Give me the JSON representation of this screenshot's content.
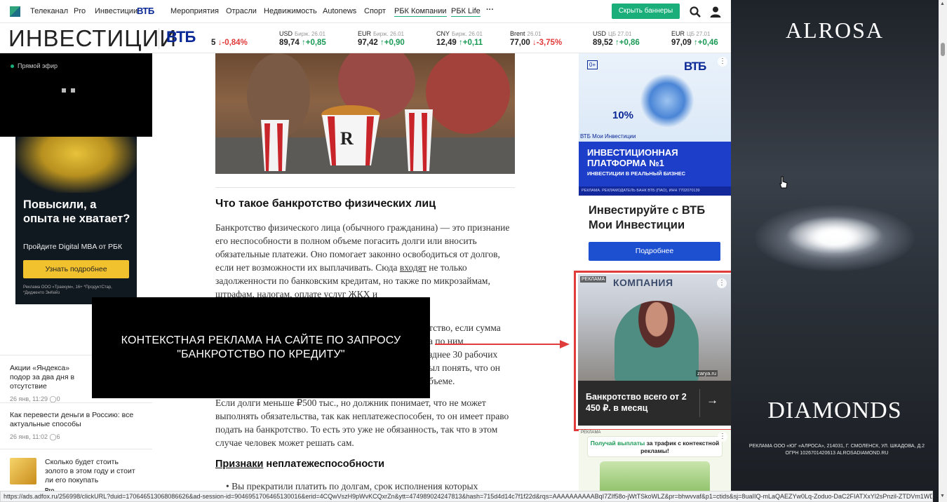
{
  "nav": {
    "items": [
      "Телеканал",
      "Pro",
      "Инвестиции",
      "ВТБ",
      "Мероприятия",
      "Отрасли",
      "Недвижимость",
      "Autonews",
      "Спорт",
      "РБК Компании",
      "РБК Life",
      "···"
    ],
    "hide_banners": "Скрыть баннеры"
  },
  "brand": {
    "title": "ИНВЕСТИЦИИ",
    "partner": "ВТБ"
  },
  "tickers": [
    {
      "name": "",
      "sub": "",
      "value": "5",
      "change": "-0,84%",
      "dir": "down"
    },
    {
      "name": "USD",
      "sub": "Бирж. 26.01",
      "value": "89,74",
      "change": "+0,85",
      "dir": "up"
    },
    {
      "name": "EUR",
      "sub": "Бирж. 26.01",
      "value": "97,42",
      "change": "+0,90",
      "dir": "up"
    },
    {
      "name": "CNY",
      "sub": "Бирж. 26.01",
      "value": "12,49",
      "change": "+0,11",
      "dir": "up"
    },
    {
      "name": "Brent",
      "sub": "26.01",
      "value": "77,00",
      "change": "-3,75%",
      "dir": "down"
    },
    {
      "name": "USD",
      "sub": "ЦБ 27.01",
      "value": "89,52",
      "change": "+0,86",
      "dir": "up"
    },
    {
      "name": "EUR",
      "sub": "ЦБ 27.01",
      "value": "97,09",
      "change": "+0,46",
      "dir": "up"
    }
  ],
  "left": {
    "live_label": "Прямой эфир",
    "mba_ad": {
      "headline": "Повысили, а опыта не хватает?",
      "sub": "Пройдите Digital MBA от РБК",
      "button": "Узнать подробнее",
      "legal": "Реклама ООО «Траекум», 16+ *ПродуктСтар, *Дидженто ЭнКейз"
    },
    "news": [
      {
        "title": "Акции «Яндекса» подор за два дня в отсутствие",
        "time": "26 янв, 11:29",
        "comments": "0"
      },
      {
        "title": "Как перевести деньги в Россию: все актуальные способы",
        "time": "26 янв, 11:02",
        "comments": "6"
      },
      {
        "title": "Сколько будет стоить золото в этом году и стоит ли его покупать",
        "badge": "Pro"
      }
    ]
  },
  "article": {
    "heading": "Что такое банкротство физических лиц",
    "p1": "Банкротство физического лица (обычного гражданина) — это признание его неспособности в полном объеме погасить долги или вносить обязательные платежи. Оно помогает законно освободиться от долгов, если нет возможности их выплачивать.",
    "p1b_pre": "Сюда ",
    "p1b_link": "входят",
    "p1b_post": " не только задолженности по банковским кредитам, но также по микрозаймам, штрафам, налогам, оплате услуг ЖКХ и",
    "p2_frag": [
      "тство, если сумма",
      "а по ним",
      "зднее 30 рабочих",
      "ыл понять, что он",
      "бъеме."
    ],
    "p3": "Если долги меньше ₽500 тыс., но должник понимает, что не может выполнять обязательства, так как неплатежеспособен, то он имеет право подать на банкротство. То есть это уже не обязанность, так что в этом случае человек может решать сам.",
    "subheading_link": "Признаки",
    "subheading_rest": " неплатежеспособности",
    "list_item": "Вы прекратили платить по долгам, срок исполнения которых"
  },
  "overlay": {
    "text": "КОНТЕКСТНАЯ РЕКЛАМА НА САЙТЕ ПО ЗАПРОСУ \"БАНКРОТСТВО ПО КРЕДИТУ\""
  },
  "right": {
    "vtb_ad": {
      "age": "0+",
      "logo": "ВТБ",
      "percent": "10%",
      "caption": "ВТБ Мои Инвестиции",
      "banner_title": "ИНВЕСТИЦИОННАЯ ПЛАТФОРМА №1",
      "banner_sub": "ИНВЕСТИЦИИ В РЕАЛЬНЫЙ БИЗНЕС",
      "legal": "РЕКЛАМА. РЕКЛАМОДАТЕЛЬ БАНК ВТБ (ПАО), ИНН 7702070139",
      "cta": "Инвестируйте с ВТБ Мои Инвестиции",
      "button": "Подробнее"
    },
    "bankrot_ad": {
      "tag": "РЕКЛАМА",
      "sign": "КОМПАНИЯ",
      "source": "zarya.ru",
      "text": "Банкротство всего от 2 450 ₽. в месяц",
      "arrow": "→"
    },
    "ctx_ad": {
      "tag": "РЕКЛАМА",
      "hl": "Получай выплаты",
      "rest": " за трафик с контекстной рекламы!"
    }
  },
  "alrosa": {
    "title": "ALROSA",
    "subtitle": "DIAMONDS",
    "legal": "РЕКЛАМА ООО «ЮГ «АЛРОСА», 214031, Г. СМОЛЕНСК, УЛ. ШКАДОВА, Д.2 ОГРН 1026701420613 ALROSADIAMOND.RU"
  },
  "status_url": "https://ads.adfox.ru/256998/clickURL?duid=170646513068086626&ad-session-id=9046951706465130016&erid=4CQwVszH9pWvKCQxrZn&ytt=474989024247813&hash=715d4d14c7f1f22d&rqs=AAAAAAAAAABqI7ZIf58o-jWtTSkoWLZ&pr=bhwvvaf&p1=ctids&sj=8uaIIQ-mLaQAEZYw0Lq-Zoduo-DaC2FIATXxYl2sPnzil-ZTDVm1WDUQX86&p..."
}
